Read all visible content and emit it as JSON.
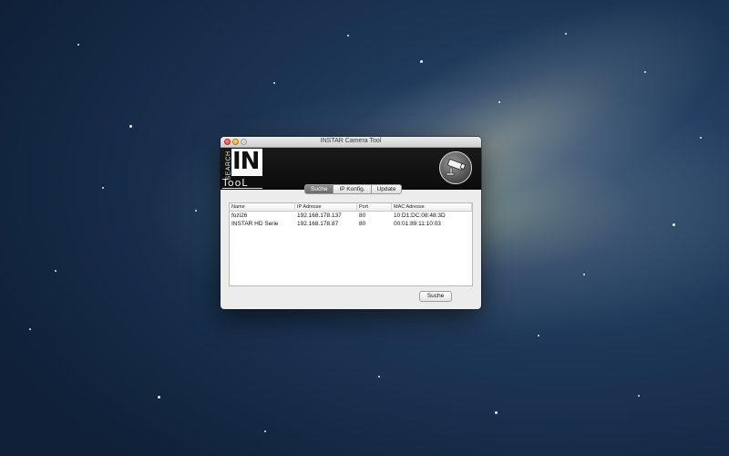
{
  "window": {
    "title": "INSTAR Camera Tool"
  },
  "logo": {
    "search_text": "SEARCH",
    "in_text": "IN",
    "tool_text": "TooL"
  },
  "tabs": [
    {
      "label": "Suche",
      "active": true
    },
    {
      "label": "IP Konfig.",
      "active": false
    },
    {
      "label": "Update",
      "active": false
    }
  ],
  "table": {
    "columns": [
      "Name",
      "IP Adresse",
      "Port",
      "MAC Adresse"
    ],
    "rows": [
      [
        "fozi26",
        "192.168.178.137",
        "80",
        "10:D1:DC:08:48:3D"
      ],
      [
        "INSTAR HD Serie",
        "192.168.178.87",
        "80",
        "00:01:89:11:10:03"
      ]
    ]
  },
  "buttons": {
    "search_label": "Suche"
  },
  "icons": {
    "camera": "security-camera-icon"
  },
  "colors": {
    "banner": "#111111",
    "active_tab": "#7a7a7a",
    "desktop": "#1d3656"
  }
}
